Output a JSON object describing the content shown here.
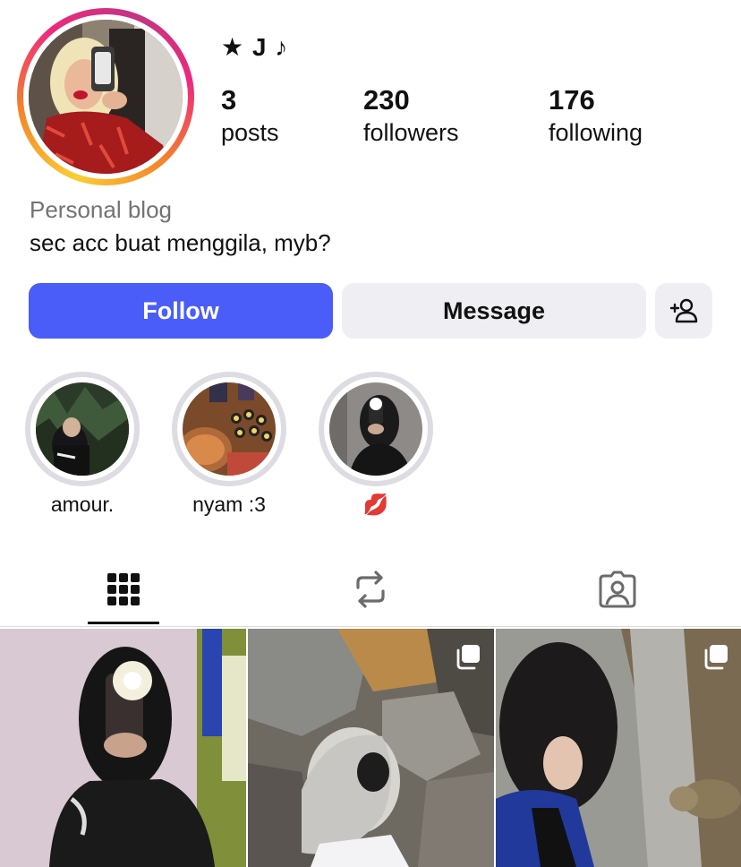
{
  "profile": {
    "display_name": "★ J ♪",
    "category": "Personal blog",
    "bio": "sec acc buat menggila, myb?"
  },
  "stats": {
    "posts": {
      "count": "3",
      "label": "posts"
    },
    "followers": {
      "count": "230",
      "label": "followers"
    },
    "following": {
      "count": "176",
      "label": "following"
    }
  },
  "actions": {
    "follow_label": "Follow",
    "message_label": "Message",
    "add_user_icon": "person-add-icon"
  },
  "colors": {
    "follow_button": "#4a5df9",
    "secondary_button": "#efeff3",
    "category_text": "#737373",
    "story_ring": [
      "#f9ce34",
      "#ee2a7b",
      "#c13584"
    ]
  },
  "highlights": [
    {
      "label": "amour."
    },
    {
      "label": "nyam :3"
    },
    {
      "label": "💋"
    }
  ],
  "tabs": [
    {
      "icon": "grid-icon",
      "active": true
    },
    {
      "icon": "reposts-icon",
      "active": false
    },
    {
      "icon": "tagged-icon",
      "active": false
    }
  ],
  "posts": [
    {
      "multi": false
    },
    {
      "multi": true
    },
    {
      "multi": true
    }
  ]
}
